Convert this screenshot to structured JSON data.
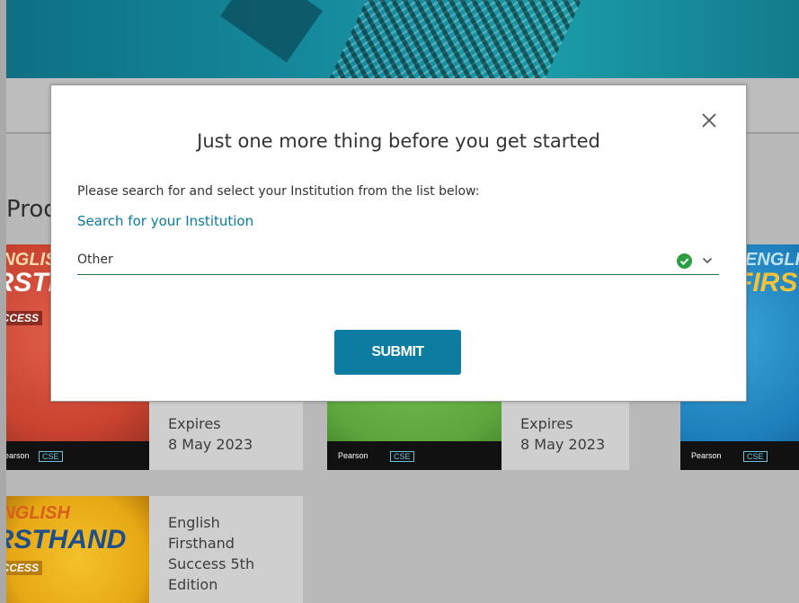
{
  "background": {
    "section_heading": "Products"
  },
  "cards": [
    {
      "cover_title_line1": "ENGLISH",
      "cover_title_line2": "FIRSTHAND",
      "cover_subtitle": "SUCCESS",
      "footer_brand": "Pearson",
      "footer_badge": "CSE",
      "expires_label": "Expires",
      "expires_date": "8 May 2023"
    },
    {
      "footer_brand": "Pearson",
      "footer_badge": "CSE",
      "expires_label": "Expires",
      "expires_date": "8 May 2023"
    },
    {
      "cover_title_line1": "ENGLISH",
      "cover_title_line2": "FIRSTHAND",
      "footer_brand": "Pearson",
      "footer_badge": "CSE"
    },
    {
      "cover_title_line1": "ENGLISH",
      "cover_title_line2": "FIRSTHAND",
      "cover_subtitle": "SUCCESS",
      "title_lines": [
        "English",
        "Firsthand",
        "Success 5th",
        "Edition"
      ]
    }
  ],
  "modal": {
    "title": "Just one more thing before you get started",
    "instruction": "Please search for and select your Institution from the list below:",
    "search_link": "Search for your Institution",
    "institution_selected": "Other",
    "submit_label": "SUBMIT",
    "close_icon": "close-icon",
    "check_icon": "check-circle-icon",
    "dropdown_icon": "chevron-down-icon"
  },
  "colors": {
    "accent": "#0c7da0",
    "link": "#0a7a9c",
    "success": "#2e9e43",
    "overlay": "#b9b9b9"
  }
}
